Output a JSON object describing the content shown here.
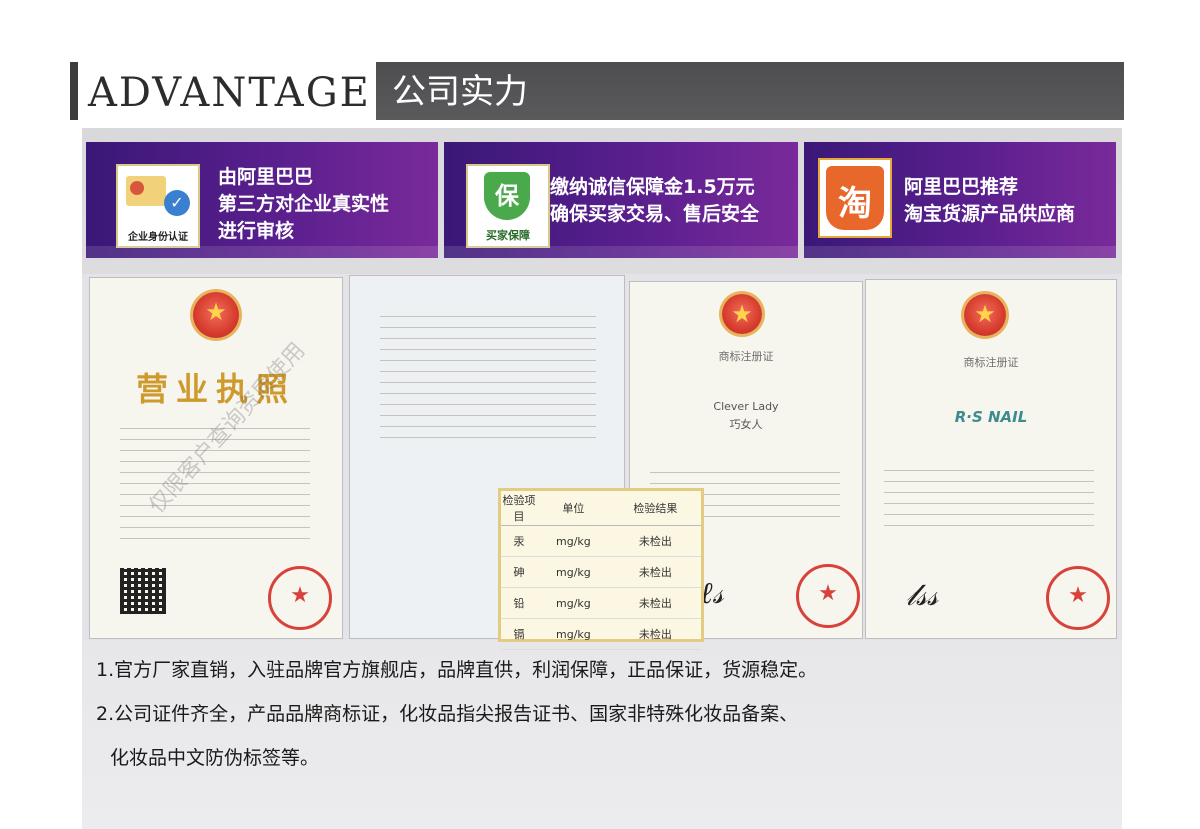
{
  "header": {
    "title_en": "ADVANTAGE",
    "title_cn": "公司实力"
  },
  "features": [
    {
      "icon": "id-card-verification-icon",
      "icon_label": "企业身份认证",
      "lines": [
        "由阿里巴巴",
        "第三方对企业真实性",
        "进行审核"
      ]
    },
    {
      "icon": "shield-guarantee-icon",
      "icon_glyph": "保",
      "icon_label": "买家保障",
      "lines": [
        "缴纳诚信保障金1.5万元",
        "确保买家交易、售后安全"
      ]
    },
    {
      "icon": "taobao-logo-icon",
      "icon_glyph": "淘",
      "lines": [
        "阿里巴巴推荐",
        "淘宝货源产品供应商"
      ]
    }
  ],
  "certificates": {
    "license": {
      "title": "营业执照",
      "watermark": "仅限客户查询资质使用"
    },
    "report": {
      "headers": [
        "检验项目",
        "单位",
        "检验结果"
      ],
      "rows": [
        [
          "汞",
          "mg/kg",
          "未检出"
        ],
        [
          "砷",
          "mg/kg",
          "未检出"
        ],
        [
          "铅",
          "mg/kg",
          "未检出"
        ],
        [
          "镉",
          "mg/kg",
          "未检出"
        ]
      ]
    },
    "trademark1": {
      "title": "商标注册证",
      "brand_en": "Clever Lady",
      "brand_cn": "巧女人"
    },
    "trademark2": {
      "title": "商标注册证",
      "brand_en": "R·S NAIL"
    }
  },
  "notes": [
    "1.官方厂家直销，入驻品牌官方旗舰店，品牌直供，利润保障，正品保证，货源稳定。",
    "2.公司证件齐全，产品品牌商标证，化妆品指尖报告证书、国家非特殊化妆品备案、",
    "化妆品中文防伪标签等。"
  ],
  "colors": {
    "card_gradient_start": "#3a1877",
    "card_gradient_end": "#7a2a9a",
    "header_bar": "#555557",
    "license_gold": "#cf9a2d",
    "stamp_red": "#d8423b"
  }
}
